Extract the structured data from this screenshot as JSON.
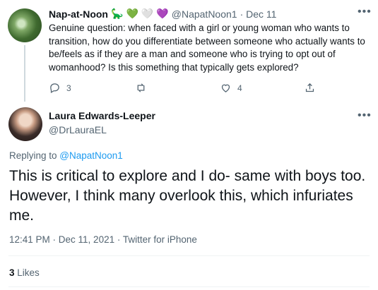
{
  "parent_tweet": {
    "name": "Nap-at-Noon",
    "emojis": [
      "🦕",
      "💚",
      "🤍",
      "💜"
    ],
    "handle": "@NapatNoon1",
    "date": "· Dec 11",
    "text": "Genuine question: when faced with a girl or young woman who wants to transition, how do you differentiate between someone who actually wants to be/feels as if they are a man and someone who is trying to opt out of womanhood? Is this something that typically gets explored?",
    "reply_count": "3",
    "like_count": "4"
  },
  "main_tweet": {
    "name": "Laura Edwards-Leeper",
    "handle": "@DrLauraEL",
    "replying_prefix": "Replying to ",
    "replying_handle": "@NapatNoon1",
    "text": "This is critical to explore and I do- same with boys too. However, I think many overlook this, which infuriates me.",
    "timestamp": "12:41 PM · Dec 11, 2021 · Twitter for iPhone",
    "likes_count": "3",
    "likes_label": "Likes"
  },
  "colors": {
    "accent": "#1d9bf0",
    "muted": "#536471"
  },
  "icons": [
    "more-icon",
    "reply-icon",
    "retweet-icon",
    "like-icon",
    "share-icon"
  ]
}
